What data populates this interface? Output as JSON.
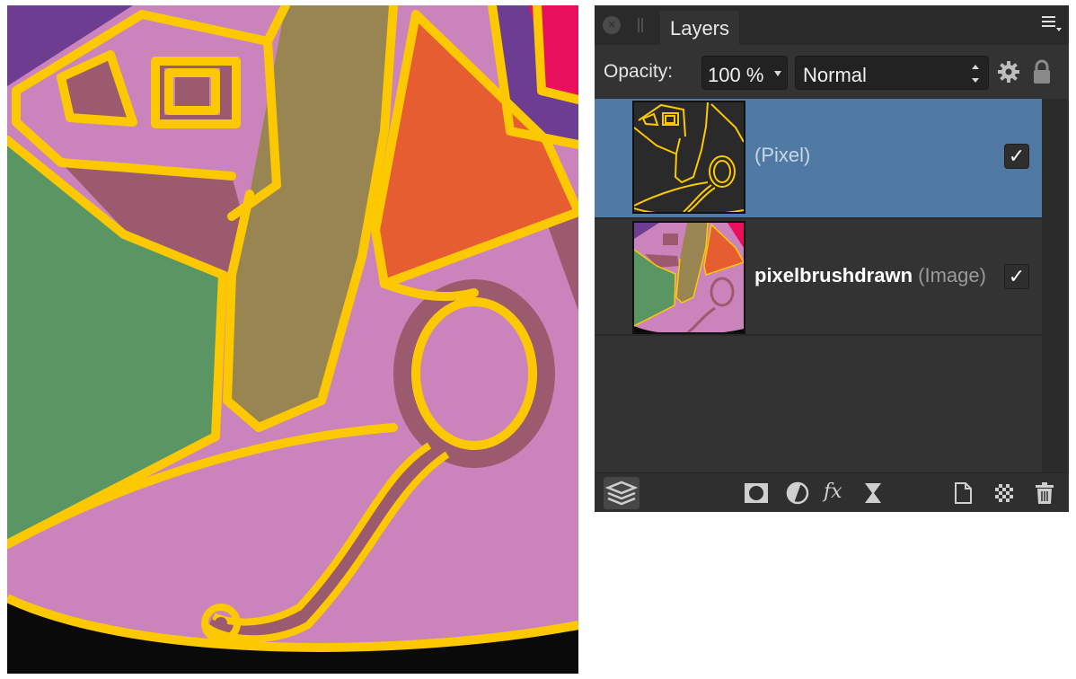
{
  "panel": {
    "tab_label": "Layers",
    "opacity_label": "Opacity:",
    "opacity_value": "100 %",
    "blend_mode": "Normal"
  },
  "layers": [
    {
      "name": "",
      "type_label": "(Pixel)",
      "visible": true,
      "selected": true
    },
    {
      "name": "pixelbrushdrawn",
      "type_label": " (Image)",
      "visible": true,
      "selected": false
    }
  ],
  "icons": {
    "close": "close-icon",
    "panel_menu": "panel-menu-icon",
    "settings": "gear-icon",
    "lock": "lock-icon",
    "layers": "layers-stack-icon",
    "mask": "mask-icon",
    "adjustment": "adjustment-icon",
    "fx": "fx-icon",
    "live_filter": "hourglass-icon",
    "new_layer": "new-document-icon",
    "fill": "checker-icon",
    "trash": "trash-icon"
  },
  "fx_glyph": "fx",
  "check_glyph": "✓",
  "colors": {
    "selection": "#5079a3",
    "panel_bg": "#333333",
    "outline_yellow": "#fcc900",
    "pink": "#cb84bb",
    "green": "#5a9564",
    "orange": "#e65d31",
    "tan": "#988552",
    "mauve": "#9b5a6d",
    "purple": "#6c3d91",
    "magenta": "#e8105c"
  }
}
